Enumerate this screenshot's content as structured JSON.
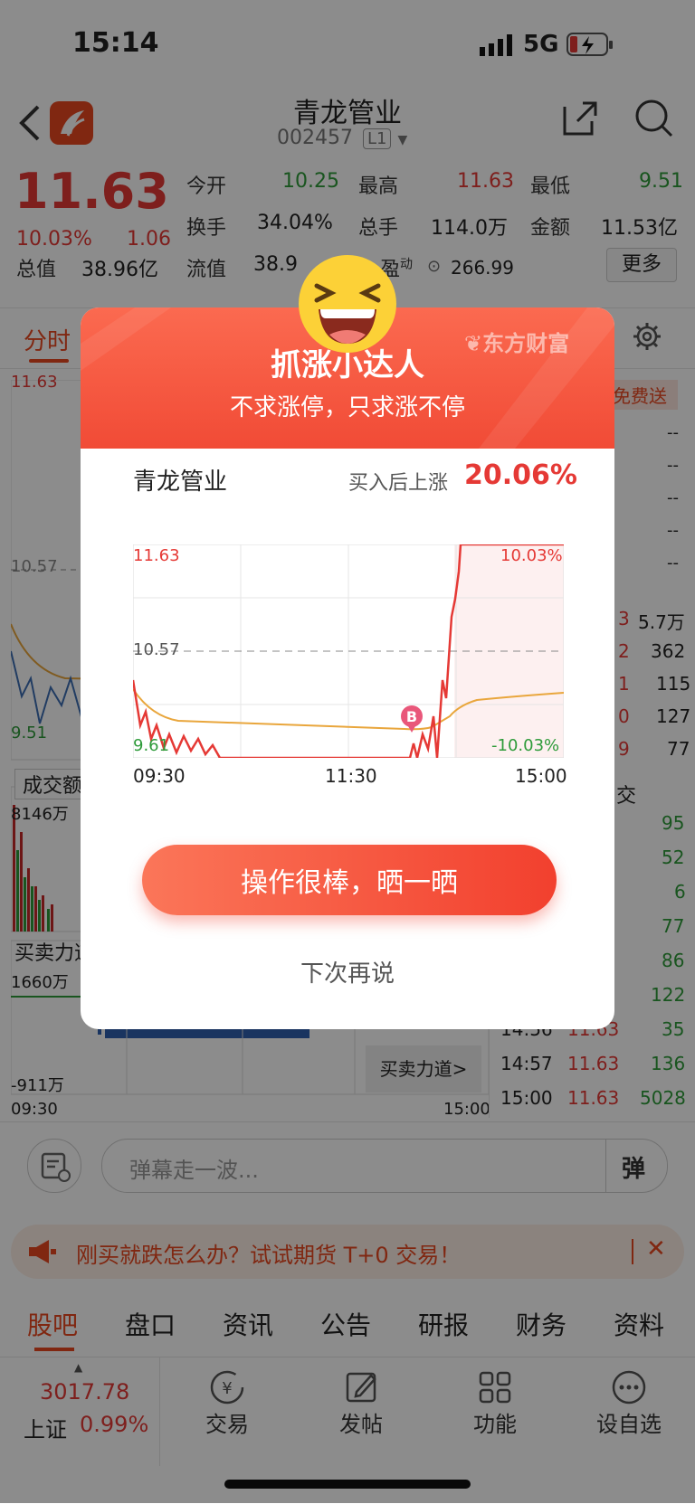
{
  "status_bar": {
    "time": "15:14",
    "network": "5G"
  },
  "header": {
    "title": "青龙管业",
    "code": "002457",
    "level": "L1"
  },
  "quote": {
    "price": "11.63",
    "change_pct": "10.03%",
    "change_abs": "1.06",
    "row1": [
      {
        "label": "今开",
        "value": "10.25"
      },
      {
        "label": "最高",
        "value": "11.63"
      },
      {
        "label": "最低",
        "value": "9.51"
      }
    ],
    "row2": [
      {
        "label": "换手",
        "value": "34.04%"
      },
      {
        "label": "总手",
        "value": "114.0万"
      },
      {
        "label": "金额",
        "value": "11.53亿"
      }
    ],
    "row3_total_label": "总值",
    "row3_total_value": "38.96亿",
    "row3_flow_label": "流值",
    "row3_flow_value": "38.9",
    "row3_pe_label": "盈",
    "row3_pe_sup": "动",
    "row3_pe_value": "266.99",
    "more_label": "更多"
  },
  "tabs": {
    "active": "分时"
  },
  "left_chart": {
    "price_high": "11.63",
    "price_mid": "10.57",
    "price_low": "9.51",
    "volume_label": "成交额",
    "volume_value": "8146万",
    "force_label": "买卖力道",
    "force_high": "1660万",
    "force_low": "-911万",
    "time_start": "09:30",
    "time_end": "15:00",
    "force_link": "买卖力道>"
  },
  "right_panel": {
    "free_label": "免费送",
    "dash_rows": [
      "--",
      "--",
      "--",
      "--",
      "--"
    ],
    "mid_rows": [
      {
        "p": "3",
        "v": "5.7万"
      },
      {
        "p": "2",
        "v": "362"
      },
      {
        "p": "1",
        "v": "115"
      },
      {
        "p": "0",
        "v": "127"
      },
      {
        "p": "9",
        "v": "77"
      }
    ],
    "trade_header": "交",
    "vol_rows": [
      "95",
      "52",
      "6",
      "77",
      "86",
      "122"
    ],
    "trades": [
      {
        "t": "14:56",
        "p": "11.63",
        "v": "35"
      },
      {
        "t": "14:57",
        "p": "11.63",
        "v": "136"
      },
      {
        "t": "15:00",
        "p": "11.63",
        "v": "5028"
      }
    ]
  },
  "comment_bar": {
    "placeholder": "弹幕走一波...",
    "danmu_label": "弹"
  },
  "promo": {
    "text": "刚买就跌怎么办？试试期货 T+0 交易！"
  },
  "bottom_tabs": [
    "股吧",
    "盘口",
    "资讯",
    "公告",
    "研报",
    "财务",
    "资料"
  ],
  "bottom_nav": {
    "index_value": "3017.78",
    "index_name": "上证",
    "index_change": "0.99%",
    "items": [
      "交易",
      "发帖",
      "功能",
      "设自选"
    ]
  },
  "modal": {
    "brand": "东方财富",
    "title": "抓涨小达人",
    "subtitle": "不求涨停，只求涨不停",
    "stock_name": "青龙管业",
    "gain_label": "买入后上涨",
    "gain_value": "20.06%",
    "chart": {
      "high": "11.63",
      "mid": "10.57",
      "low": "9.61",
      "pct_high": "10.03%",
      "pct_low": "-10.03%",
      "x_start": "09:30",
      "x_mid": "11:30",
      "x_end": "15:00",
      "buy_marker": "B"
    },
    "primary_button": "操作很棒，晒一晒",
    "secondary_button": "下次再说"
  }
}
